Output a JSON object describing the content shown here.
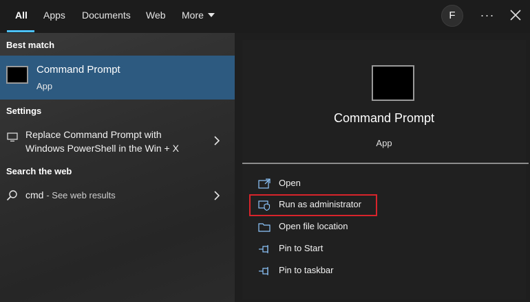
{
  "tabs": [
    {
      "label": "All",
      "active": true
    },
    {
      "label": "Apps"
    },
    {
      "label": "Documents"
    },
    {
      "label": "Web"
    },
    {
      "label": "More"
    }
  ],
  "header": {
    "avatar_initial": "F",
    "more_options": "···"
  },
  "colors": {
    "accent": "#4cc2ff",
    "selected_bg": "#2d5a80",
    "highlight_border": "#d9242b"
  },
  "best_match": {
    "heading": "Best match",
    "title": "Command Prompt",
    "subtitle": "App"
  },
  "settings": {
    "heading": "Settings",
    "item_line1": "Replace Command Prompt with",
    "item_line2": "Windows PowerShell in the Win + X"
  },
  "web": {
    "heading": "Search the web",
    "query": "cmd",
    "suffix": "- See web results"
  },
  "details": {
    "title": "Command Prompt",
    "subtitle": "App"
  },
  "actions": [
    {
      "label": "Open",
      "icon": "open-icon"
    },
    {
      "label": "Run as administrator",
      "icon": "shield-icon"
    },
    {
      "label": "Open file location",
      "icon": "folder-icon"
    },
    {
      "label": "Pin to Start",
      "icon": "pin-icon"
    },
    {
      "label": "Pin to taskbar",
      "icon": "pin-icon"
    }
  ]
}
